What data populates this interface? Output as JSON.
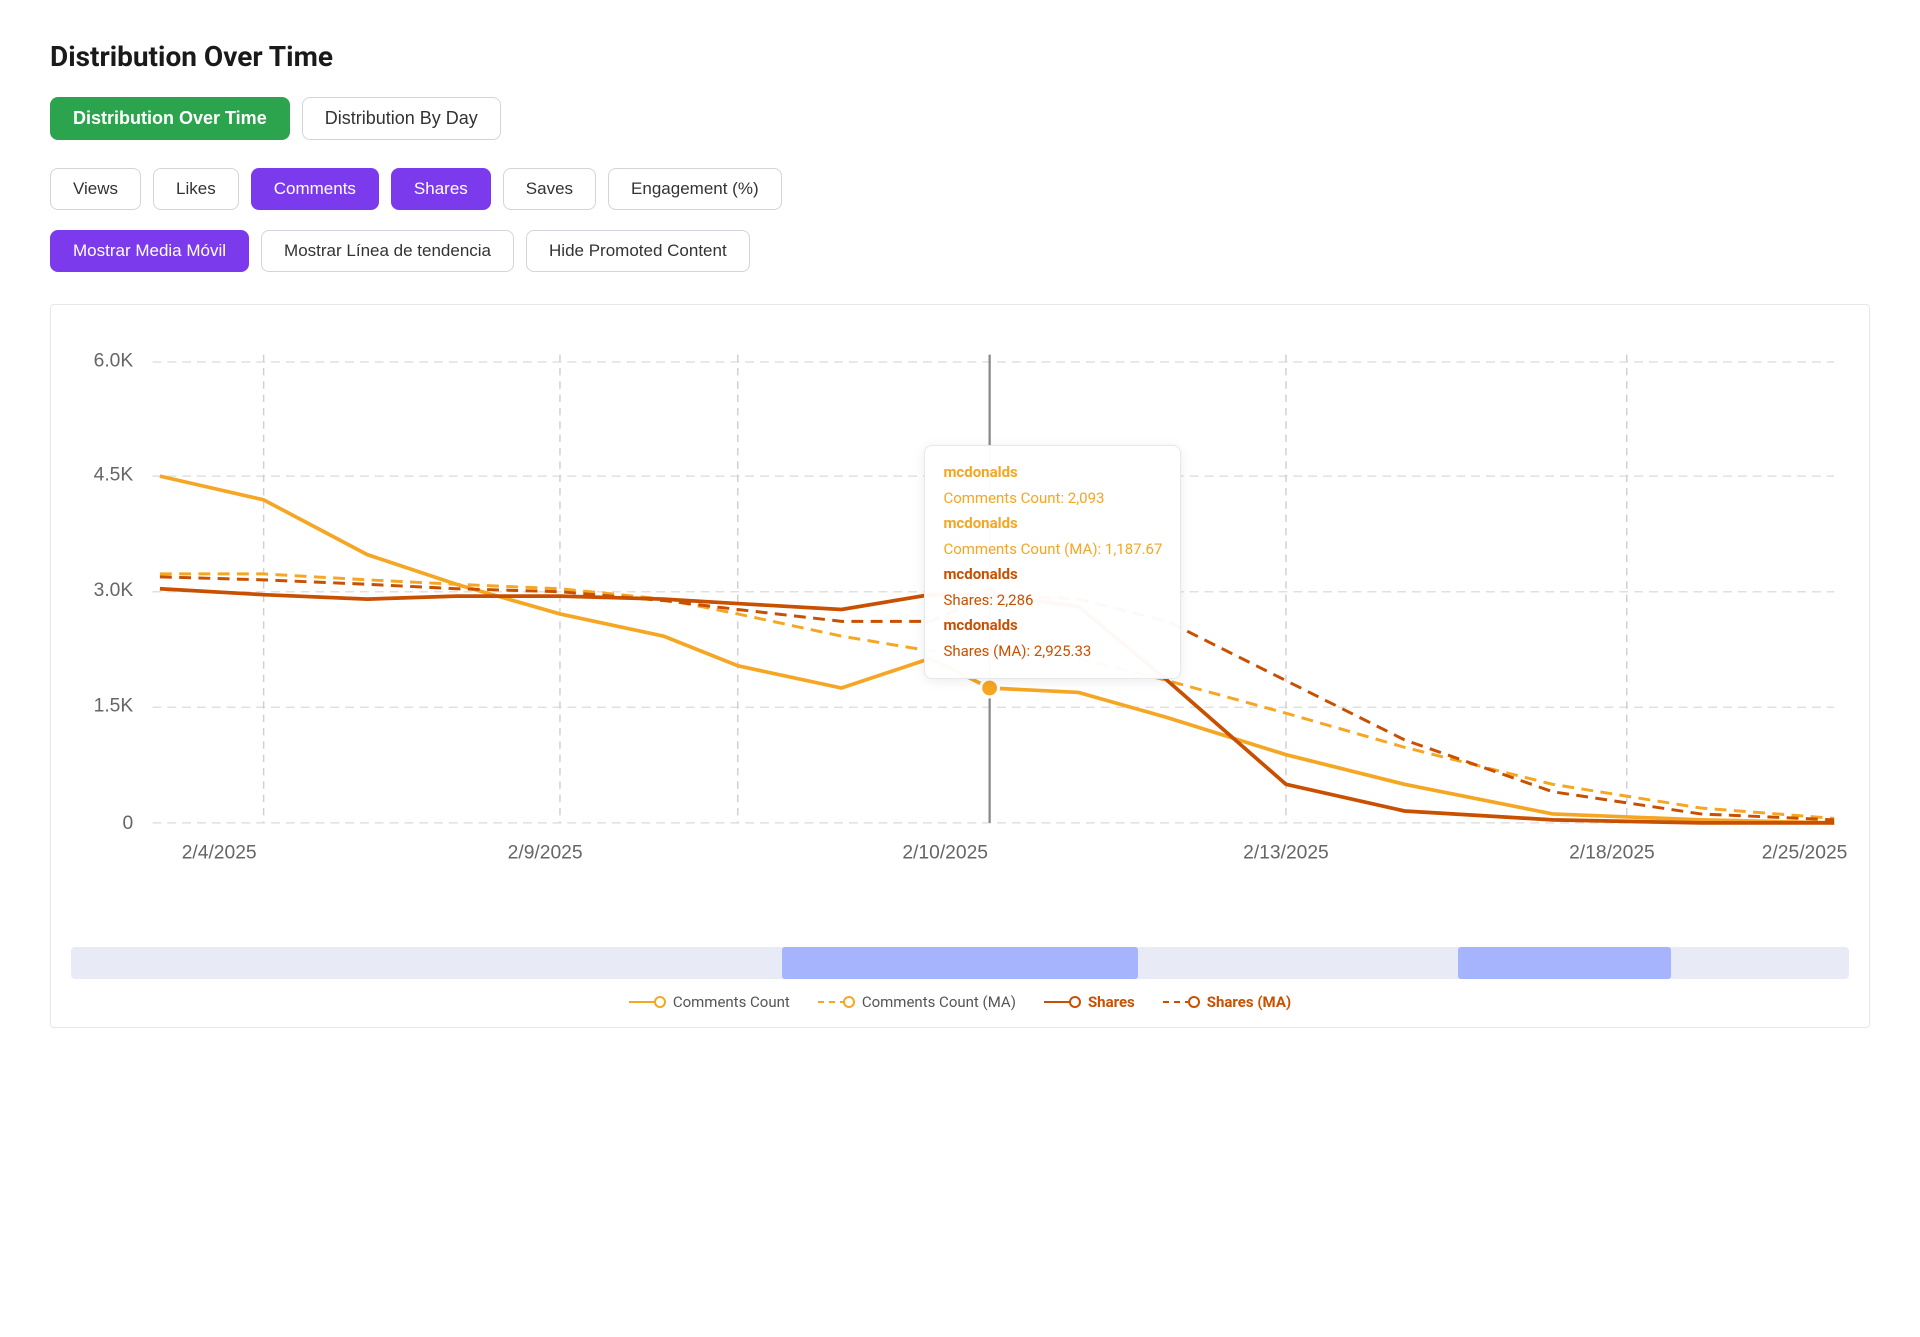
{
  "page": {
    "title": "Distribution Over Time"
  },
  "tabs": [
    {
      "id": "over-time",
      "label": "Distribution Over Time",
      "active": true
    },
    {
      "id": "by-day",
      "label": "Distribution By Day",
      "active": false
    }
  ],
  "metrics": [
    {
      "id": "views",
      "label": "Views",
      "active": false
    },
    {
      "id": "likes",
      "label": "Likes",
      "active": false
    },
    {
      "id": "comments",
      "label": "Comments",
      "active": true
    },
    {
      "id": "shares",
      "label": "Shares",
      "active": true
    },
    {
      "id": "saves",
      "label": "Saves",
      "active": false
    },
    {
      "id": "engagement",
      "label": "Engagement (%)",
      "active": false
    }
  ],
  "toggles": [
    {
      "id": "moving-avg",
      "label": "Mostrar Media Móvil",
      "active": true
    },
    {
      "id": "trend-line",
      "label": "Mostrar Línea de tendencia",
      "active": false
    },
    {
      "id": "hide-promoted",
      "label": "Hide Promoted Content",
      "active": false
    }
  ],
  "tooltip": {
    "brand1": "mcdonalds",
    "comments_label": "Comments Count: 2,093",
    "brand2": "mcdonalds",
    "comments_ma_label": "Comments Count (MA): 1,187.67",
    "brand3": "mcdonalds",
    "shares_label": "Shares: 2,286",
    "brand4": "mcdonalds",
    "shares_ma_label": "Shares (MA): 2,925.33"
  },
  "xaxis": [
    "2/4/2025",
    "2/9/2025",
    "2/10/2025",
    "2/13/2025",
    "2/18/2025",
    "2/25/2025"
  ],
  "yaxis": [
    "6.0K",
    "4.5K",
    "3.0K",
    "1.5K",
    "0"
  ],
  "legend": [
    {
      "id": "comments-count",
      "label": "Comments Count",
      "color": "#f5a623",
      "style": "solid"
    },
    {
      "id": "comments-count-ma",
      "label": "Comments Count (MA)",
      "color": "#f5a623",
      "style": "dashed"
    },
    {
      "id": "shares",
      "label": "Shares",
      "color": "#c85000",
      "style": "solid"
    },
    {
      "id": "shares-ma",
      "label": "Shares (MA)",
      "color": "#c85000",
      "style": "dashed"
    }
  ],
  "colors": {
    "active_green": "#2ca44e",
    "active_purple": "#7c3aed",
    "comments_orange": "#f5a623",
    "shares_dark": "#c85000",
    "tooltip_brand_comments": "#f5a623",
    "tooltip_brand_shares": "#c85000"
  }
}
